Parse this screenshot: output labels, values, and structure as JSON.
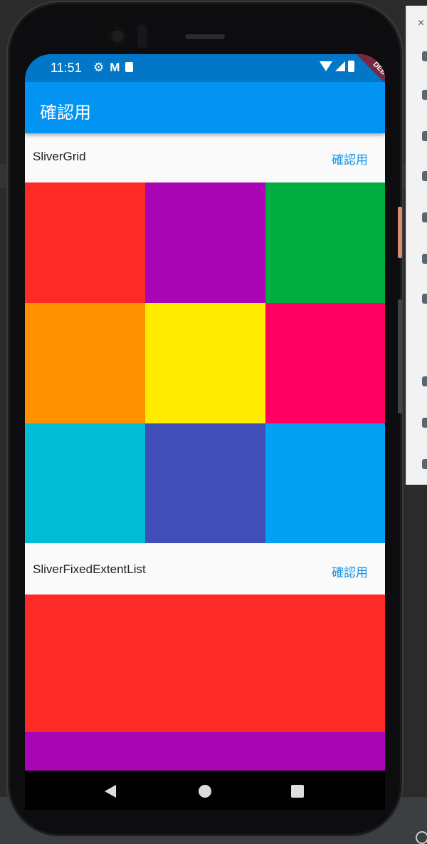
{
  "status_bar": {
    "time": "11:51",
    "icons_left": [
      "gear-icon",
      "gmail-icon",
      "sd-card-icon"
    ],
    "icons_right": [
      "wifi-icon",
      "signal-icon",
      "battery-icon"
    ]
  },
  "debug_banner": "DEBUG",
  "app_bar": {
    "title": "確認用"
  },
  "sections": {
    "grid": {
      "title": "SliverGrid",
      "action": "確認用"
    },
    "list": {
      "title": "SliverFixedExtentList",
      "action": "確認用"
    }
  },
  "grid_colors": [
    "#fe2a25",
    "#a905b5",
    "#00ad40",
    "#ff9100",
    "#ffea00",
    "#fe0060",
    "#00bcd5",
    "#3f4fb7",
    "#03a0f4"
  ],
  "list_colors": [
    "#fe2a25",
    "#a905b5"
  ],
  "colors": {
    "status_bar": "#0277c8",
    "app_bar": "#0394f3",
    "action_text": "#1495e8"
  }
}
